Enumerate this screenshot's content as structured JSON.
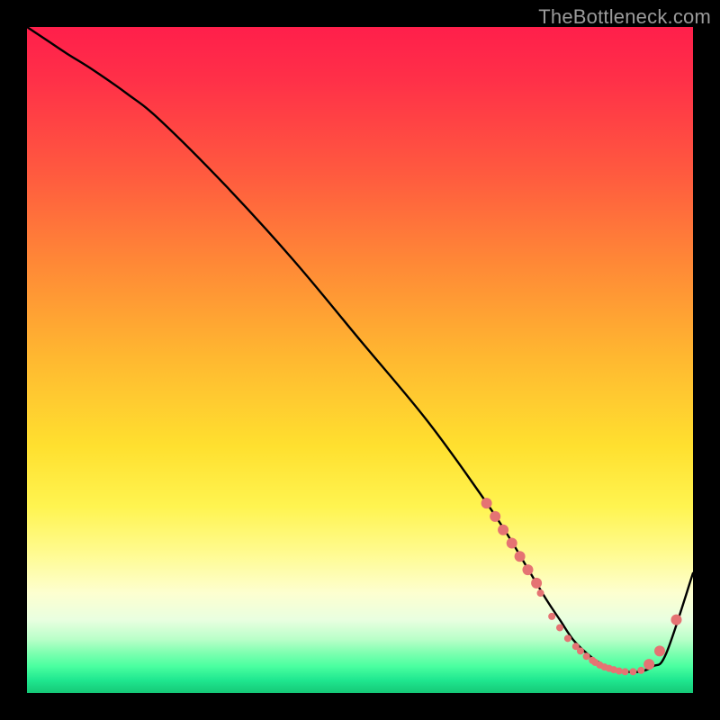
{
  "watermark": "TheBottleneck.com",
  "chart_data": {
    "type": "line",
    "title": "",
    "xlabel": "",
    "ylabel": "",
    "xlim": [
      0,
      100
    ],
    "ylim": [
      0,
      100
    ],
    "grid": false,
    "legend": false,
    "background_gradient": {
      "stops": [
        {
          "pos": 0.0,
          "color": "#ff1f4b"
        },
        {
          "pos": 0.5,
          "color": "#ffe02f"
        },
        {
          "pos": 0.85,
          "color": "#fdffd0"
        },
        {
          "pos": 1.0,
          "color": "#15c877"
        }
      ]
    },
    "series": [
      {
        "name": "bottleneck-curve",
        "color": "#000000",
        "x": [
          0,
          3,
          6,
          10,
          15,
          20,
          30,
          40,
          50,
          60,
          68,
          72,
          75,
          78,
          80,
          82,
          84,
          86,
          88,
          90,
          92,
          94,
          96,
          100
        ],
        "y": [
          100,
          98,
          96,
          93.5,
          90,
          86,
          76,
          65,
          53,
          41,
          30,
          24,
          19,
          14,
          11,
          8,
          6,
          4.5,
          3.5,
          3.2,
          3.2,
          4,
          6,
          18
        ]
      }
    ],
    "markers": {
      "name": "highlight-dots",
      "color": "#e57373",
      "radius_main": 6,
      "radius_small": 4,
      "points": [
        {
          "x": 69.0,
          "y": 28.5,
          "r": 6
        },
        {
          "x": 70.3,
          "y": 26.5,
          "r": 6
        },
        {
          "x": 71.5,
          "y": 24.5,
          "r": 6
        },
        {
          "x": 72.8,
          "y": 22.5,
          "r": 6
        },
        {
          "x": 74.0,
          "y": 20.5,
          "r": 6
        },
        {
          "x": 75.2,
          "y": 18.5,
          "r": 6
        },
        {
          "x": 76.5,
          "y": 16.5,
          "r": 6
        },
        {
          "x": 77.1,
          "y": 15.0,
          "r": 4
        },
        {
          "x": 78.8,
          "y": 11.5,
          "r": 4
        },
        {
          "x": 80.0,
          "y": 9.8,
          "r": 4
        },
        {
          "x": 81.2,
          "y": 8.2,
          "r": 4
        },
        {
          "x": 82.4,
          "y": 7.0,
          "r": 4
        },
        {
          "x": 83.1,
          "y": 6.3,
          "r": 4
        },
        {
          "x": 84.0,
          "y": 5.5,
          "r": 4
        },
        {
          "x": 84.9,
          "y": 4.9,
          "r": 4
        },
        {
          "x": 85.3,
          "y": 4.6,
          "r": 4
        },
        {
          "x": 86.0,
          "y": 4.2,
          "r": 4
        },
        {
          "x": 86.7,
          "y": 3.9,
          "r": 4
        },
        {
          "x": 87.4,
          "y": 3.7,
          "r": 4
        },
        {
          "x": 88.1,
          "y": 3.5,
          "r": 4
        },
        {
          "x": 88.9,
          "y": 3.3,
          "r": 4
        },
        {
          "x": 89.8,
          "y": 3.2,
          "r": 4
        },
        {
          "x": 91.0,
          "y": 3.2,
          "r": 4
        },
        {
          "x": 92.2,
          "y": 3.4,
          "r": 4
        },
        {
          "x": 93.4,
          "y": 4.3,
          "r": 6
        },
        {
          "x": 95.0,
          "y": 6.3,
          "r": 6
        },
        {
          "x": 97.5,
          "y": 11.0,
          "r": 6
        }
      ]
    }
  }
}
